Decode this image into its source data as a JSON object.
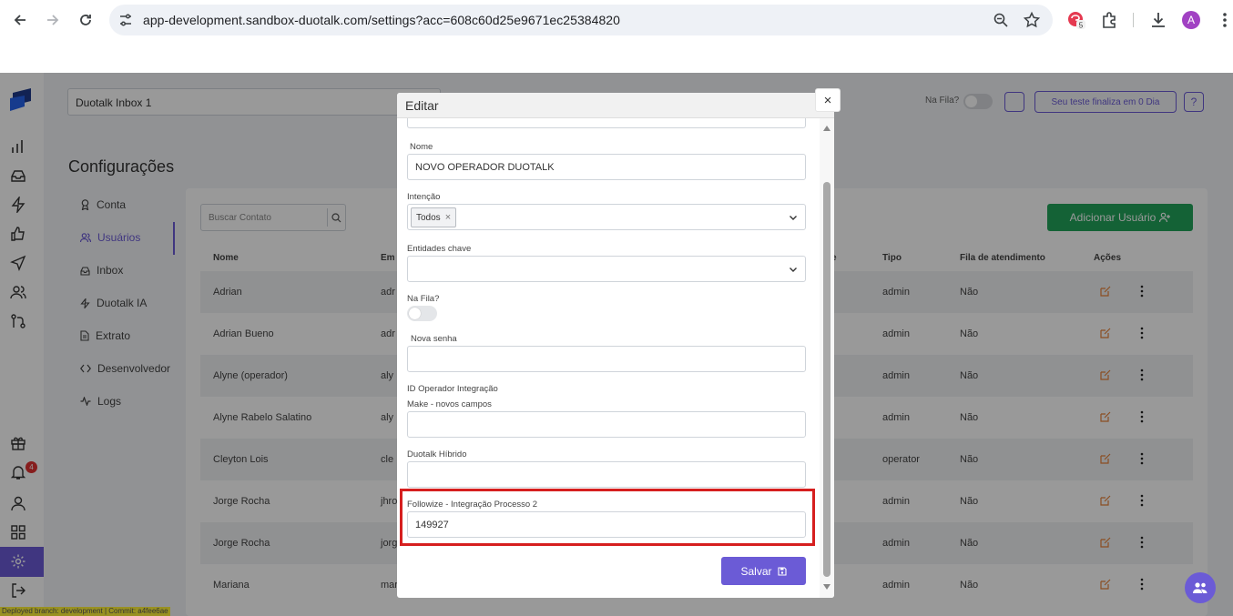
{
  "browser": {
    "url": "app-development.sandbox-duotalk.com/settings?acc=608c60d25e9671ec25384820",
    "extension_badge": "5",
    "profile_initial": "A"
  },
  "topbar": {
    "inbox_selected": "Duotalk Inbox 1",
    "queue_label": "Na Fila?",
    "trial_text": "Seu teste finaliza em 0 Dia",
    "help_label": "?"
  },
  "leftbar": {
    "notification_count": "4",
    "deploy_info": "Deployed branch: development | Commit: a4fee6ae"
  },
  "page": {
    "title": "Configurações"
  },
  "settings_nav": {
    "items": [
      {
        "label": "Conta",
        "icon": "award-icon"
      },
      {
        "label": "Usuários",
        "icon": "users-icon"
      },
      {
        "label": "Inbox",
        "icon": "inbox-icon"
      },
      {
        "label": "Duotalk IA",
        "icon": "zap-icon"
      },
      {
        "label": "Extrato",
        "icon": "file-icon"
      },
      {
        "label": "Desenvolvedor",
        "icon": "code-icon"
      },
      {
        "label": "Logs",
        "icon": "activity-icon"
      }
    ]
  },
  "users_panel": {
    "search_placeholder": "Buscar Contato",
    "add_button": "Adicionar Usuário",
    "columns": {
      "name": "Nome",
      "email": "Em",
      "e": "e",
      "type": "Tipo",
      "queue": "Fila de atendimento",
      "actions": "Ações"
    },
    "rows": [
      {
        "name": "Adrian",
        "email": "adr",
        "type": "admin",
        "queue": "Não"
      },
      {
        "name": "Adrian Bueno",
        "email": "adr",
        "type": "admin",
        "queue": "Não"
      },
      {
        "name": "Alyne (operador)",
        "email": "aly",
        "type": "admin",
        "queue": "Não"
      },
      {
        "name": "Alyne Rabelo Salatino",
        "email": "aly",
        "type": "admin",
        "queue": "Não"
      },
      {
        "name": "Cleyton Lois",
        "email": "cle",
        "type": "operator",
        "queue": "Não"
      },
      {
        "name": "Jorge Rocha",
        "email": "jhro",
        "type": "admin",
        "queue": "Não"
      },
      {
        "name": "Jorge Rocha",
        "email": "jorg",
        "type": "admin",
        "queue": "Não"
      },
      {
        "name": "Mariana",
        "email": "mar",
        "type": "admin",
        "queue": "Não"
      }
    ]
  },
  "modal": {
    "title": "Editar",
    "close_label": "×",
    "name_label": "Nome",
    "name_value": "NOVO OPERADOR DUOTALK",
    "intent_label": "Intenção",
    "intent_chip": "Todos",
    "entities_label": "Entidades chave",
    "queue_label": "Na Fila?",
    "password_label": "Nova senha",
    "integration_section": "ID Operador Integração",
    "make_label": "Make - novos campos",
    "make_value": "",
    "hybrid_label": "Duotalk Híbrido",
    "hybrid_value": "",
    "followize_label": "Followize - Integração Processo 2",
    "followize_value": "149927",
    "save_button": "Salvar"
  },
  "colors": {
    "accent": "#6b5bd6",
    "success": "#22a35a",
    "highlight": "#d61f1f",
    "edit_icon": "#e8833a"
  }
}
